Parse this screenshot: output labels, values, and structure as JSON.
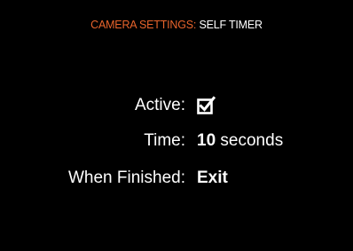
{
  "header": {
    "section": "CAMERA SETTINGS:",
    "page": "SELF TIMER"
  },
  "settings": {
    "active": {
      "label": "Active:",
      "checked": true,
      "icon": "checkbox-checked-icon"
    },
    "time": {
      "label": "Time:",
      "value": "10",
      "unit": "seconds"
    },
    "when_finished": {
      "label": "When Finished:",
      "value": "Exit"
    }
  },
  "colors": {
    "background": "#000000",
    "accent": "#e8642c",
    "text": "#ffffff"
  }
}
